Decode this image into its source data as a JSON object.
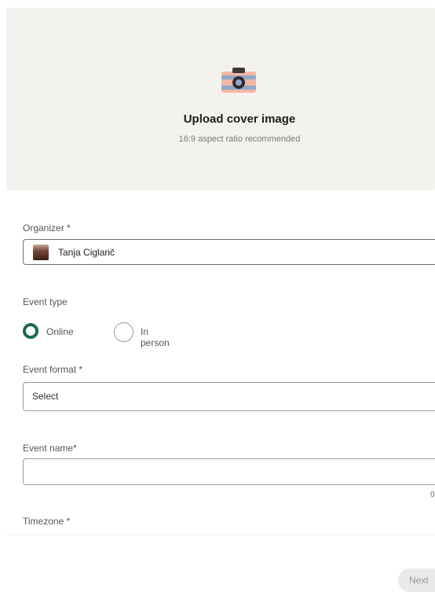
{
  "cover": {
    "title": "Upload cover image",
    "subtitle": "16:9 aspect ratio recommended",
    "icon": "camera-icon"
  },
  "organizer": {
    "label": "Organizer *",
    "value": "Tanja Ciglarič"
  },
  "event_type": {
    "label": "Event type",
    "options": [
      {
        "label": "Online",
        "selected": true
      },
      {
        "label": "In person",
        "selected": false
      }
    ]
  },
  "event_format": {
    "label": "Event format *",
    "value": "Select"
  },
  "event_name": {
    "label": "Event name*",
    "value": "",
    "counter": "0"
  },
  "timezone": {
    "label": "Timezone *"
  },
  "footer": {
    "next_label": "Next"
  },
  "colors": {
    "accent": "#1f6b4a",
    "cover_bg": "#f3f2ef"
  }
}
